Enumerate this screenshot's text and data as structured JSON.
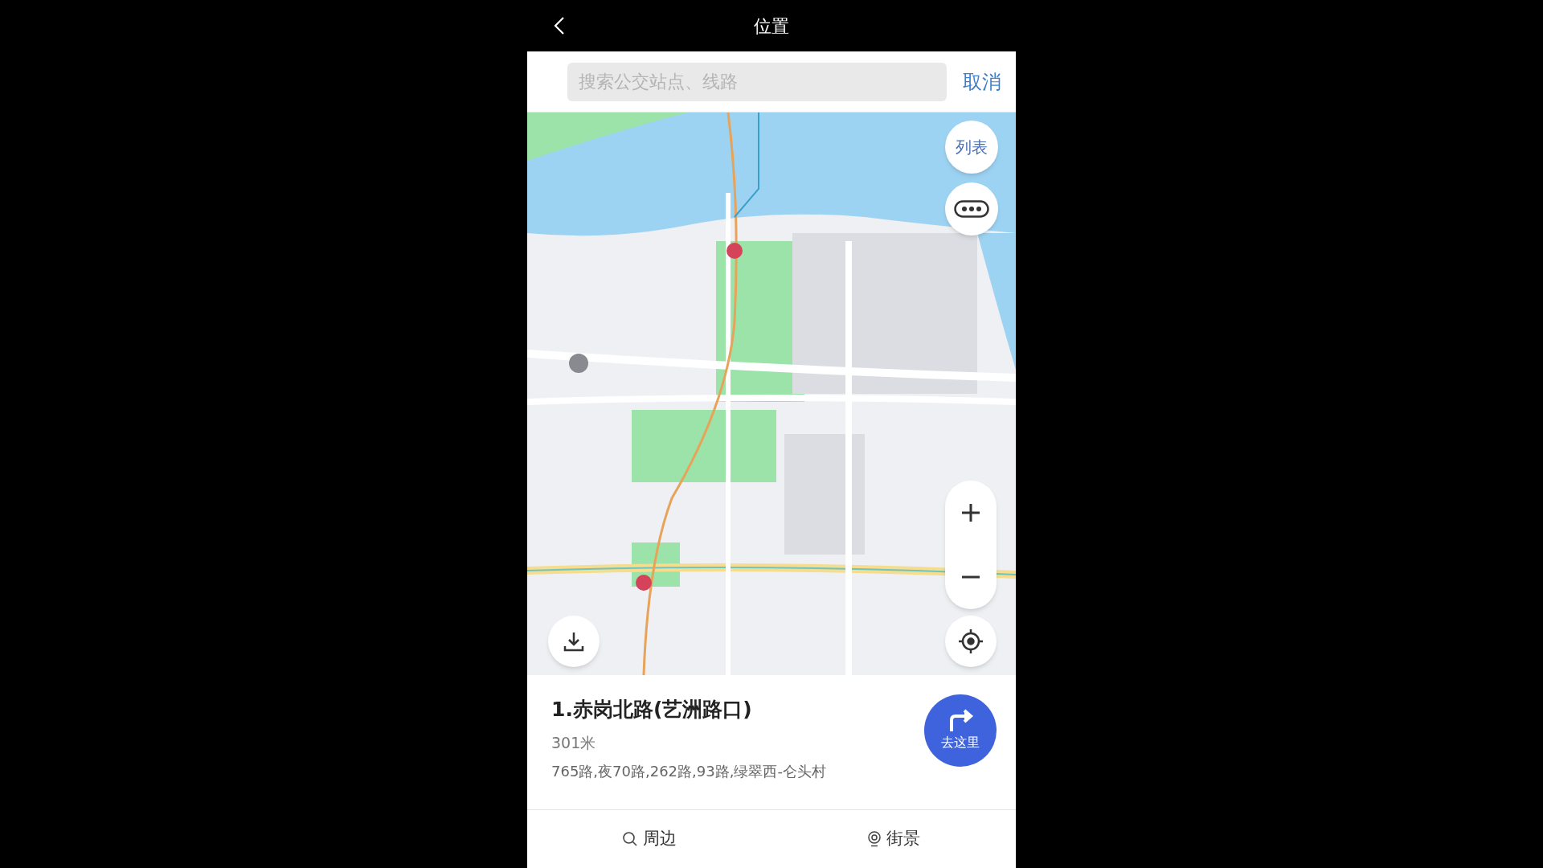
{
  "header": {
    "title": "位置"
  },
  "search": {
    "placeholder": "搜索公交站点、线路",
    "cancel": "取消"
  },
  "map": {
    "list_button": "列表"
  },
  "result": {
    "title": "1.赤岗北路(艺洲路口)",
    "distance": "301米",
    "routes": "765路,夜70路,262路,93路,绿翠西-仑头村",
    "go_button": "去这里"
  },
  "bottom_actions": [
    {
      "kind": "search",
      "label": "周边"
    },
    {
      "kind": "pin",
      "label": "街景"
    }
  ]
}
